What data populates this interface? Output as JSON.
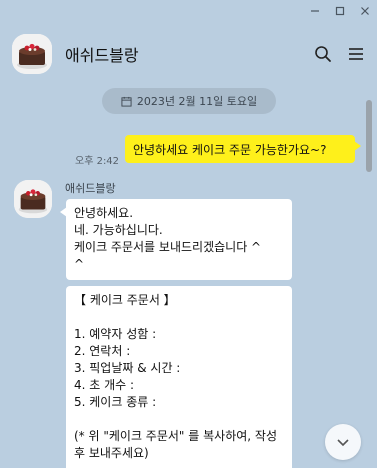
{
  "window": {
    "controls": [
      "minimize-icon",
      "maximize-icon",
      "close-icon"
    ]
  },
  "header": {
    "title": "애쉬드블랑",
    "icons": [
      "search-icon",
      "menu-icon"
    ]
  },
  "date_divider": {
    "icon": "calendar-icon",
    "text": "2023년 2월 11일 토요일"
  },
  "messages": {
    "sent": {
      "time": "오후 2:42",
      "text": "안녕하세요 케이크 주문 가능한가요~?"
    },
    "received": {
      "sender": "애쉬드블랑",
      "bubble1": {
        "lines": [
          "안녕하세요.",
          "네. 가능하십니다.",
          "케이크 주문서를 보내드리겠습니다  ^",
          "^"
        ]
      },
      "bubble2": {
        "lines": [
          "【 케이크 주문서 】",
          "",
          "1. 예약자 성함 :",
          "2. 연락처 :",
          "3. 픽업날짜 & 시간 :",
          "4. 초 개수 :",
          "5. 케이크 종류 :",
          "",
          "(* 위 \"케이크 주문서\" 를 복사하여, 작성후 보내주세요)"
        ]
      }
    }
  },
  "scroll_down_icon": "chevron-down-icon"
}
